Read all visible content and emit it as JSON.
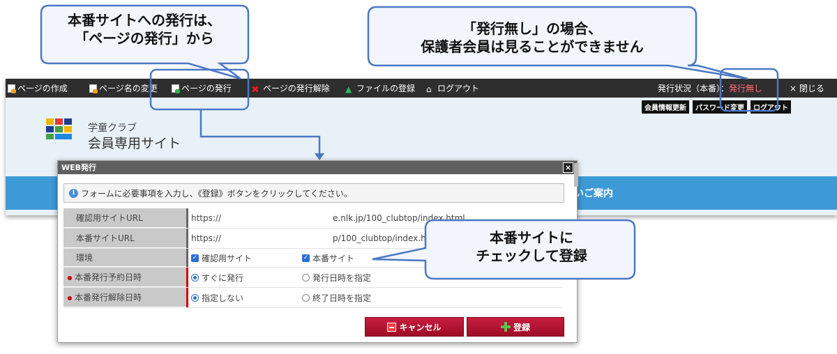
{
  "toolbar": {
    "items": [
      {
        "label": "ページの作成",
        "icon": "page-add-icon"
      },
      {
        "label": "ページ名の変更",
        "icon": "page-rename-icon"
      },
      {
        "label": "ページの発行",
        "icon": "page-publish-icon"
      },
      {
        "label": "ページの発行解除",
        "icon": "unpublish-x-icon"
      },
      {
        "label": "ファイルの登録",
        "icon": "upload-arrow-icon"
      },
      {
        "label": "ログアウト",
        "icon": "home-icon"
      }
    ],
    "status_label": "発行状況（本番）：",
    "status_value": "発行無し",
    "close": "× 閉じる"
  },
  "subnav": {
    "update": "会員情報更新",
    "password": "パスワード変更",
    "logout": "ログアウト"
  },
  "site": {
    "subtitle": "学童クラブ",
    "title": "会員専用サイト",
    "band_text": "いご案内"
  },
  "dialog": {
    "title": "WEB発行",
    "close": "×",
    "notice": "フォームに必要事項を入力し、《登録》ボタンをクリックしてください。",
    "rows": {
      "confirm_url": {
        "label": "確認用サイトURL",
        "value": "https://",
        "value_tail": "e.nlk.jp/100_clubtop/index.html"
      },
      "prod_url": {
        "label": "本番サイトURL",
        "value": "https://",
        "value_tail": "p/100_clubtop/index.html"
      },
      "env": {
        "label": "環境",
        "opt1": "確認用サイト",
        "opt2": "本番サイト"
      },
      "schedule": {
        "label": "本番発行予約日時",
        "opt1": "すぐに発行",
        "opt2": "発行日時を指定"
      },
      "unpublish": {
        "label": "本番発行解除日時",
        "opt1": "指定しない",
        "opt2": "終了日時を指定"
      }
    },
    "cancel": "キャンセル",
    "submit": "登録"
  },
  "callouts": {
    "c1_line1": "本番サイトへの発行は、",
    "c1_line2": "「ページの発行」から",
    "c2_line1": "「発行無し」の場合、",
    "c2_line2": "保護者会員は見ることができません",
    "c3_line1": "本番サイトに",
    "c3_line2": "チェックして登録"
  },
  "colors": {
    "toolbar_bg": "#2e2e2e",
    "band_blue": "#3d9ad6",
    "button_red": "#b00a2a",
    "callout_border": "#4a78c4",
    "status_red": "#ff6b6b"
  }
}
